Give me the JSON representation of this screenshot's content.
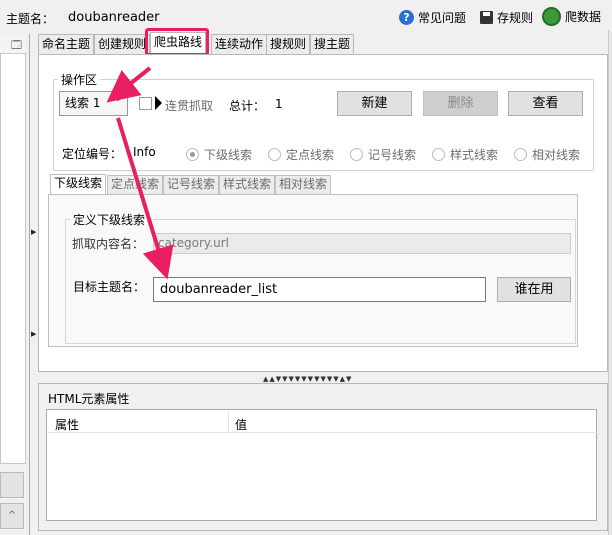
{
  "header": {
    "topic_label": "主题名：",
    "topic_value": "doubanreader",
    "faq": "常见问题",
    "save_rule": "存规则",
    "crawl_data": "爬数据"
  },
  "left_panel": {
    "header_icon": "🗔",
    "scroll_up_glyph": "^"
  },
  "main_tabs": [
    "命名主题",
    "创建规则",
    "爬虫路线",
    "连续动作",
    "搜规则",
    "搜主题"
  ],
  "active_main_tab": "爬虫路线",
  "operation_area": {
    "title": "操作区",
    "thread_select": "线索 1",
    "continuous_label": "连贯抓取",
    "total_label": "总计：",
    "total_value": "1",
    "buttons": {
      "new": "新建",
      "delete": "删除",
      "view": "查看"
    },
    "locate_label": "定位编号：",
    "locate_value": "Info",
    "radios": [
      "下级线索",
      "定点线索",
      "记号线索",
      "样式线索",
      "相对线索"
    ],
    "selected_radio": "下级线索"
  },
  "sub_tabs": [
    "下级线索",
    "定点线索",
    "记号线索",
    "样式线索",
    "相对线索"
  ],
  "active_sub_tab": "下级线索",
  "define": {
    "title": "定义下级线索",
    "fetch_label": "抓取内容名：",
    "fetch_value": "category.url",
    "target_label": "目标主题名：",
    "target_value": "doubanreader_list",
    "who_uses": "谁在用"
  },
  "html_panel": {
    "title": "HTML元素属性",
    "columns": [
      "属性",
      "值"
    ]
  },
  "colors": {
    "highlight": "#e91e63",
    "accent_blue": "#2a6fd6",
    "globe_green": "#3a9a3a"
  },
  "icons": [
    "help-circle-icon",
    "save-icon",
    "globe-icon",
    "chevron-down-icon",
    "play-arrow-icon"
  ]
}
